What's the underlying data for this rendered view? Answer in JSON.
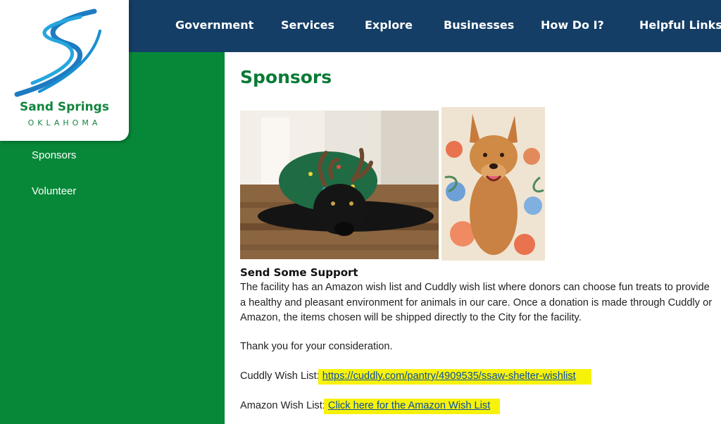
{
  "nav": {
    "items": [
      {
        "label": "Government"
      },
      {
        "label": "Services"
      },
      {
        "label": "Explore"
      },
      {
        "label": "Businesses"
      },
      {
        "label": "How Do I?"
      },
      {
        "label": "Helpful Links"
      }
    ]
  },
  "logo": {
    "name": "Sand Springs",
    "state": "OKLAHOMA"
  },
  "sidebar": {
    "items": [
      {
        "label": "Sponsors"
      },
      {
        "label": "Volunteer"
      }
    ]
  },
  "page": {
    "title": "Sponsors",
    "section_heading": "Send Some Support",
    "paragraph": "The facility has an Amazon wish list and Cuddly wish list where donors can choose fun treats to provide a healthy and pleasant environment for animals in our care. Once a donation is made through Cuddly or Amazon, the items chosen will be shipped directly to the City for the facility.",
    "thanks": "Thank you for your consideration.",
    "cuddly_label": "Cuddly Wish List: ",
    "cuddly_link": "https://cuddly.com/pantry/4909535/ssaw-shelter-wishlist",
    "amazon_label": "Amazon Wish List: ",
    "amazon_link": "Click here for the Amazon Wish List"
  },
  "colors": {
    "nav_bg": "#143e66",
    "sidebar_bg": "#078838",
    "title_green": "#0a7a35",
    "highlight": "#f7f20a",
    "link": "#0b4ea2"
  }
}
